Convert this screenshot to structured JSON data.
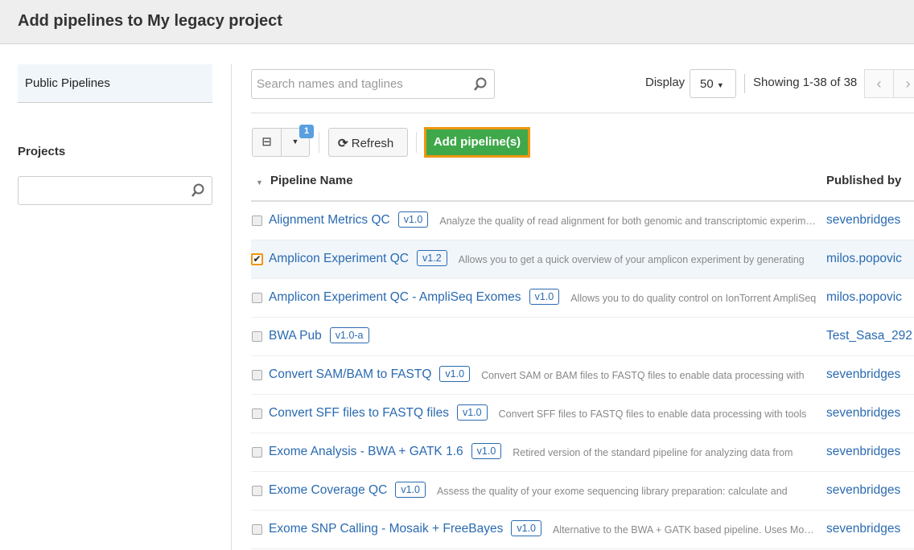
{
  "header": {
    "title": "Add pipelines to My legacy project"
  },
  "sidebar": {
    "items": [
      {
        "label": "Public Pipelines"
      }
    ],
    "projects_label": "Projects",
    "projects_search": ""
  },
  "toolbar": {
    "search_placeholder": "Search names and taglines",
    "display_label": "Display",
    "display_value": "50",
    "showing": "Showing 1-38 of 38",
    "selected_count": "1",
    "refresh_label": "Refresh",
    "add_label": "Add pipeline(s)"
  },
  "table": {
    "columns": [
      "Pipeline Name",
      "Published by"
    ],
    "rows": [
      {
        "name": "Alignment Metrics QC",
        "version": "v1.0",
        "desc": "Analyze the quality of read alignment for both genomic and transcriptomic experiments",
        "publisher": "sevenbridges",
        "checked": false
      },
      {
        "name": "Amplicon Experiment QC",
        "version": "v1.2",
        "desc": "Allows you to get a quick overview of your amplicon experiment by generating",
        "publisher": "milos.popovic",
        "checked": true
      },
      {
        "name": "Amplicon Experiment QC - AmpliSeq Exomes",
        "version": "v1.0",
        "desc": "Allows you to do quality control on IonTorrent AmpliSeq",
        "publisher": "milos.popovic",
        "checked": false
      },
      {
        "name": "BWA Pub",
        "version": "v1.0-a",
        "desc": "",
        "publisher": "Test_Sasa_292",
        "checked": false
      },
      {
        "name": "Convert SAM/BAM to FASTQ",
        "version": "v1.0",
        "desc": "Convert SAM or BAM files to FASTQ files to enable data processing with",
        "publisher": "sevenbridges",
        "checked": false
      },
      {
        "name": "Convert SFF files to FASTQ files",
        "version": "v1.0",
        "desc": "Convert SFF files to FASTQ files to enable data processing with tools",
        "publisher": "sevenbridges",
        "checked": false
      },
      {
        "name": "Exome Analysis - BWA + GATK 1.6",
        "version": "v1.0",
        "desc": "Retired version of the standard pipeline for analyzing data from",
        "publisher": "sevenbridges",
        "checked": false
      },
      {
        "name": "Exome Coverage QC",
        "version": "v1.0",
        "desc": "Assess the quality of your exome sequencing library preparation: calculate and",
        "publisher": "sevenbridges",
        "checked": false
      },
      {
        "name": "Exome SNP Calling - Mosaik + FreeBayes",
        "version": "v1.0",
        "desc": "Alternative to the BWA + GATK based pipeline. Uses Mosaik",
        "publisher": "sevenbridges",
        "checked": false
      }
    ]
  },
  "colors": {
    "link": "#2a6ab0",
    "add_button": "#3fa84a",
    "highlight": "#f0960e",
    "badge": "#5a9fe0"
  }
}
